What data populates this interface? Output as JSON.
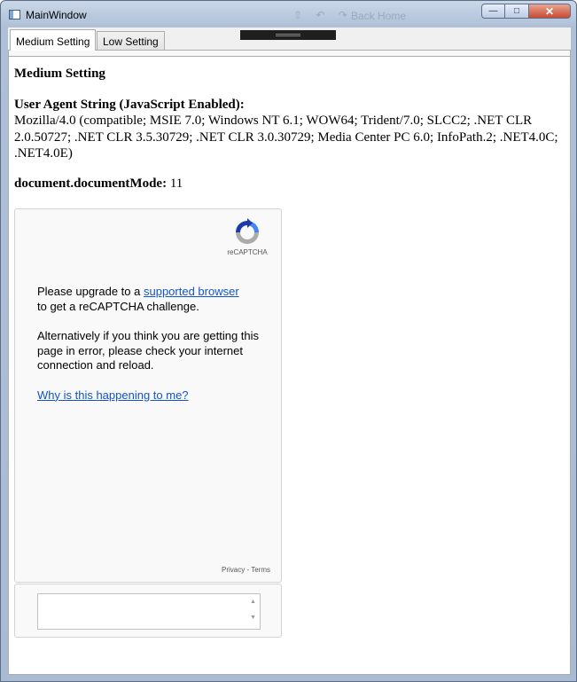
{
  "window": {
    "title": "MainWindow",
    "ghost_title": "Back Home",
    "ghost_icons": "⇧ ↶ ↷",
    "buttons": {
      "minimize": "—",
      "maximize": "□",
      "close": "✕"
    }
  },
  "tabs": [
    {
      "label": "Medium Setting",
      "active": true
    },
    {
      "label": "Low Setting",
      "active": false
    }
  ],
  "page": {
    "heading": "Medium Setting",
    "ua_label": "User Agent String (JavaScript Enabled):",
    "ua_value": "Mozilla/4.0 (compatible; MSIE 7.0; Windows NT 6.1; WOW64; Trident/7.0; SLCC2; .NET CLR 2.0.50727; .NET CLR 3.5.30729; .NET CLR 3.0.30729; Media Center PC 6.0; InfoPath.2; .NET4.0C; .NET4.0E)",
    "doc_mode_label": "document.documentMode:",
    "doc_mode_value": "11"
  },
  "recaptcha": {
    "logo_text": "reCAPTCHA",
    "msg1_prefix": "Please upgrade to a ",
    "msg1_link": "supported browser",
    "msg1_suffix": "to get a reCAPTCHA challenge.",
    "msg2": "Alternatively if you think you are getting this page in error, please check your internet connection and reload.",
    "why_link": "Why is this happening to me?",
    "privacy": "Privacy",
    "separator": " - ",
    "terms": "Terms",
    "textarea_value": ""
  },
  "colors": {
    "link": "#1155cc",
    "recaptcha_blue": "#1c3aa9",
    "recaptcha_lightblue": "#4285f4",
    "recaptcha_grey": "#ababab"
  }
}
